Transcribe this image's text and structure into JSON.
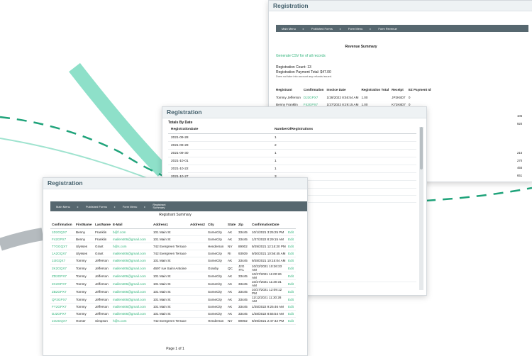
{
  "colors": {
    "accent": "#2fb37a",
    "nav_bg": "#56676f",
    "title_bar": "#eef2f4",
    "title_text": "#44606c",
    "deco_teal": "#7fdcc2",
    "deco_gray": "#9aa0a4"
  },
  "nav": {
    "main_menu": "Main Menu",
    "published_forms": "Published Forms",
    "form_menu": "Form Menu",
    "form_revenue": "Form Revenue",
    "registrant_summary": "Registrant Summary",
    "sep": "▸"
  },
  "revenue_window": {
    "title": "Registration",
    "summary_title": "Revenue Summary",
    "csv_link": "Generate CSV for of all records",
    "registration_count": "Registration Count: 13",
    "registration_payment_total": "Registration Payment Total: $47.00",
    "note": "Does not take into account any refunds issued.",
    "headers": [
      "Registrant",
      "Confirmation",
      "Invoice Date",
      "Registration Total",
      "Receipt",
      "EZ Payment Id"
    ],
    "rows": [
      [
        "Tommy Jefferson",
        "DJ2GPX7",
        "1/28/2022 8:55:54 AM",
        "1.00",
        "JP2K8D7",
        "0"
      ],
      [
        "Benny Franklin",
        "F42GPX7",
        "1/27/2022 8:29:15 AM",
        "1.00",
        "K72K8D7",
        "0"
      ]
    ],
    "side_values": [
      "106",
      "920",
      "215",
      "270",
      "455",
      "651"
    ]
  },
  "totals_window": {
    "title": "Registration",
    "section_title": "Totals By Date",
    "headers": [
      "RegistrationDate",
      "NumberOfRegistrations"
    ],
    "rows": [
      [
        "2021-09-28",
        "1"
      ],
      [
        "2021-09-29",
        "2"
      ],
      [
        "2021-09-30",
        "1"
      ],
      [
        "2021-10-01",
        "1"
      ],
      [
        "2021-10-22",
        "1"
      ],
      [
        "2021-10-27",
        "3"
      ],
      [
        "2021-11-12",
        "1"
      ]
    ]
  },
  "registrant_window": {
    "title": "Registration",
    "summary_title": "Registrant Summary",
    "headers": [
      "Confirmation",
      "FirstName",
      "LastName",
      "E-Mail",
      "Address1",
      "Address2",
      "City",
      "State",
      "Zip",
      "ConfirmationDate",
      ""
    ],
    "rows": [
      [
        "1D2GQX7",
        "Benny",
        "Franklin",
        "b@f.com",
        "101 Main St",
        "",
        "SomeCity",
        "AK",
        "33445",
        "10/1/2021 3:25:25 PM",
        "Edit"
      ],
      [
        "F42GPX7",
        "Benny",
        "Franklin",
        "mallen606@gmail.com",
        "101 Main St",
        "",
        "SomeCity",
        "AK",
        "33445",
        "1/27/2022 8:29:15 AM",
        "Edit"
      ],
      [
        "T7GGQX7",
        "Ulysses",
        "Grant",
        "h@s.com",
        "742 Evergreen Terrace",
        "",
        "Henderson",
        "NV",
        "89002",
        "9/29/2021 12:15:20 PM",
        "Edit"
      ],
      [
        "1A2GQX7",
        "Ulysses",
        "Grant",
        "mallen606@gmail.com",
        "742 Evergreen Terrace",
        "",
        "SomeCity",
        "RI",
        "93939",
        "9/30/2021 10:56:45 AM",
        "Edit"
      ],
      [
        "1I2GQX7",
        "Tommy",
        "Jefferson",
        "mallen606@gmail.com",
        "101 Main St",
        "",
        "SomeCity",
        "AK",
        "33445",
        "9/28/2021 10:15:04 AM",
        "Edit"
      ],
      [
        "2K2GQX7",
        "Tommy",
        "Jefferson",
        "mallen606@gmail.com",
        "4697 rue Saint-Antoine",
        "",
        "Granby",
        "QC",
        "J2G 7T1",
        "10/22/2021 10:26:33 AM",
        "Edit"
      ],
      [
        "ZD2GPX7",
        "Tommy",
        "Jefferson",
        "mallen606@gmail.com",
        "101 Main St",
        "",
        "SomeCity",
        "AK",
        "33445",
        "10/27/2021 11:00:26 AM",
        "Edit"
      ],
      [
        "2C2GPX7",
        "Tommy",
        "Jefferson",
        "mallen606@gmail.com",
        "101 Main St",
        "",
        "SomeCity",
        "AK",
        "33445",
        "10/27/2021 11:30:31 AM",
        "Edit"
      ],
      [
        "ZB2GPX7",
        "Tommy",
        "Jefferson",
        "mallen606@gmail.com",
        "101 Main St",
        "",
        "SomeCity",
        "AK",
        "33445",
        "10/27/2021 12:09:12 PM",
        "Edit"
      ],
      [
        "QF2GPX7",
        "Tommy",
        "Jefferson",
        "mallen606@gmail.com",
        "101 Main St",
        "",
        "SomeCity",
        "AK",
        "33445",
        "11/12/2021 11:30:28 AM",
        "Edit"
      ],
      [
        "FY2GPX7",
        "Tommy",
        "Jefferson",
        "mallen606@gmail.com",
        "101 Main St",
        "",
        "SomeCity",
        "AK",
        "33445",
        "1/25/2022 9:25:46 AM",
        "Edit"
      ],
      [
        "DJ2GPX7",
        "Tommy",
        "Jefferson",
        "mallen606@gmail.com",
        "101 Main St",
        "",
        "SomeCity",
        "AK",
        "33445",
        "1/28/2022 8:55:54 AM",
        "Edit"
      ],
      [
        "1O2GQX7",
        "Homer",
        "Simpson",
        "h@s.com",
        "742 Evergreen Terrace",
        "",
        "Henderson",
        "NV",
        "89002",
        "9/29/2021 2:47:42 PM",
        "Edit"
      ]
    ],
    "page_info": "Page 1 of 1"
  }
}
